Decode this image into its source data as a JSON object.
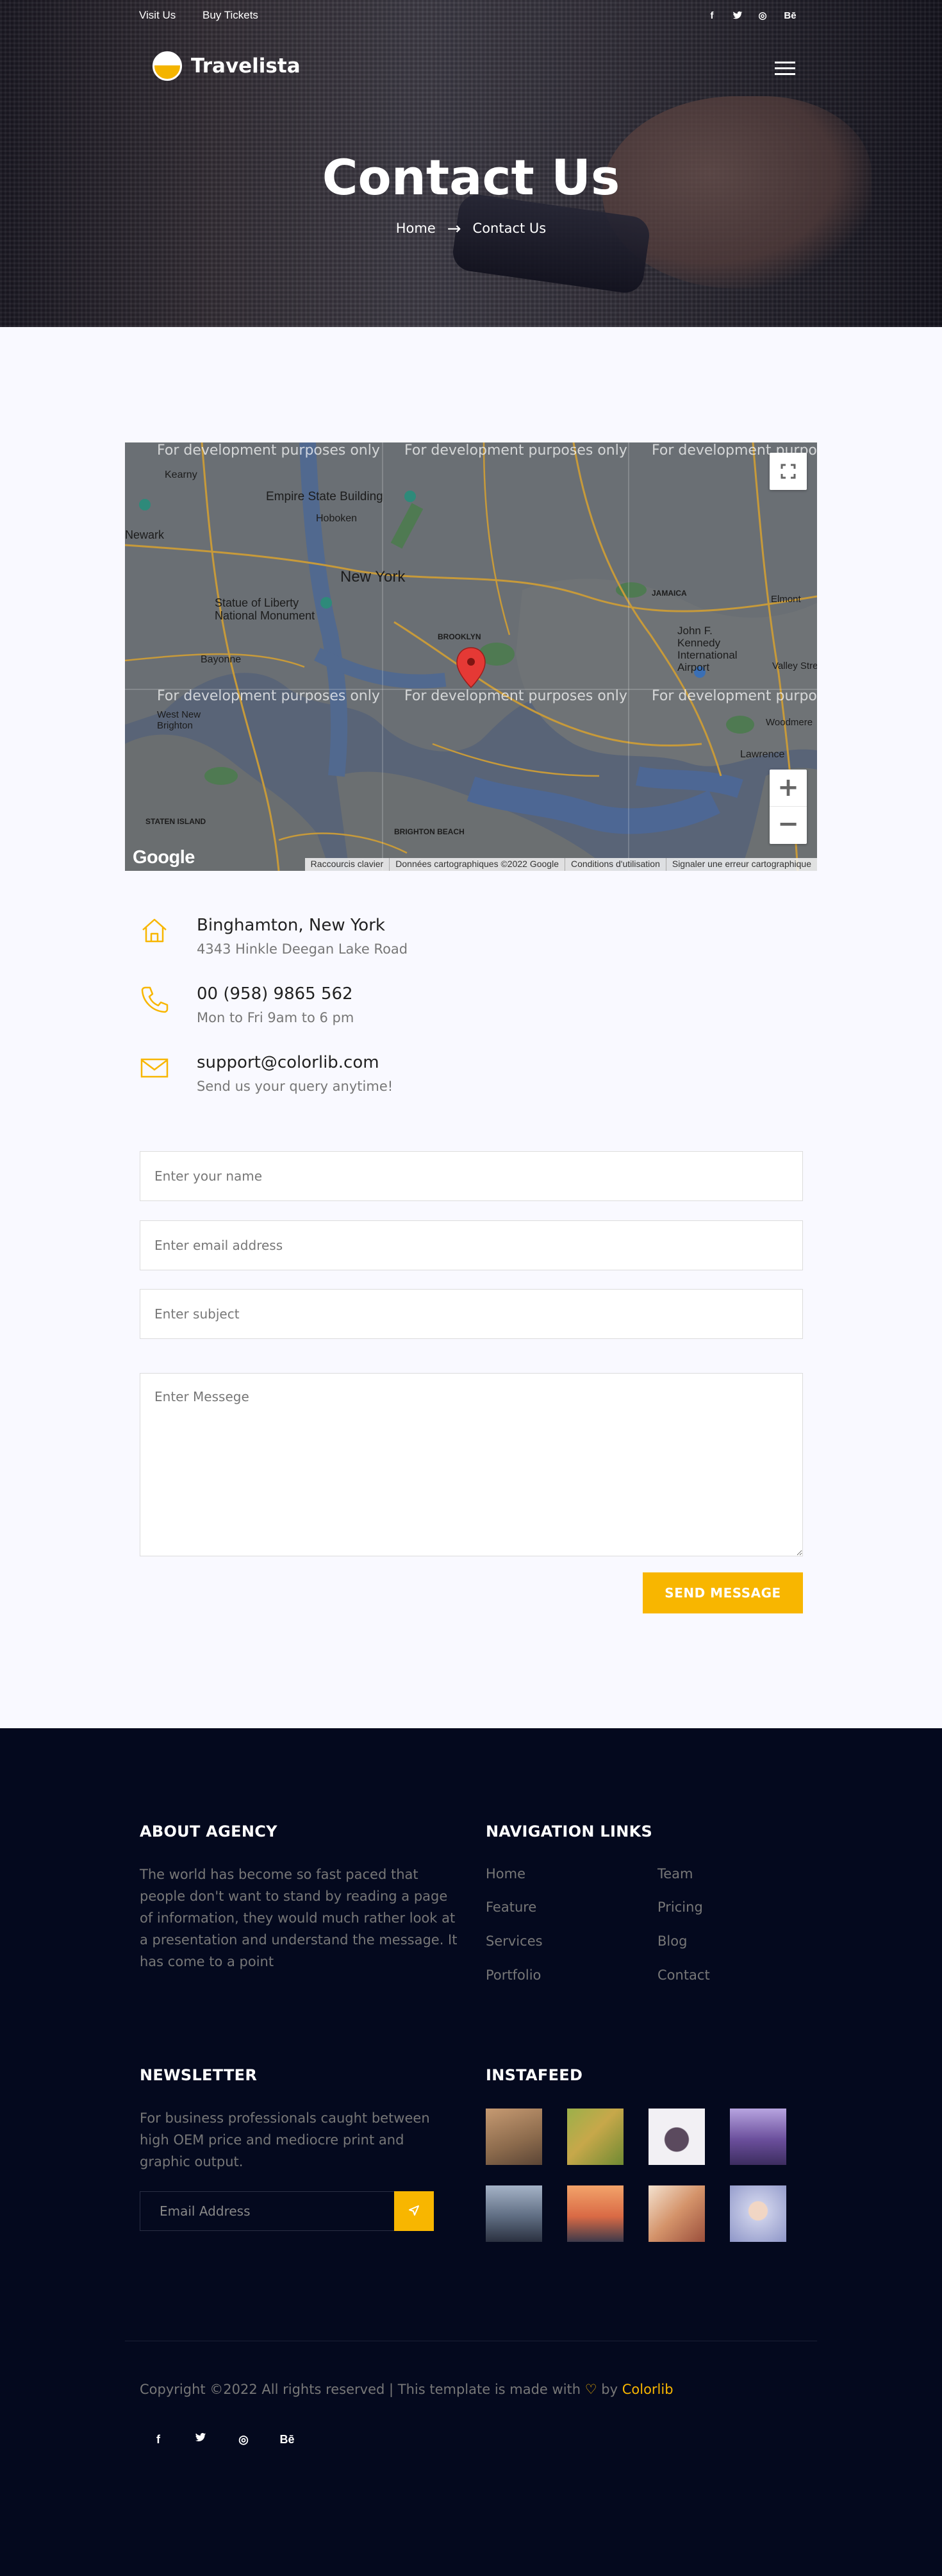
{
  "topbar": {
    "links": [
      "Visit Us",
      "Buy Tickets"
    ],
    "social": [
      {
        "icon": "facebook-icon",
        "glyph": "f"
      },
      {
        "icon": "twitter-icon",
        "glyph": "t"
      },
      {
        "icon": "dribbble-icon",
        "glyph": "◎"
      },
      {
        "icon": "behance-icon",
        "glyph": "Bē"
      }
    ]
  },
  "brand": {
    "name": "Travelista"
  },
  "hero": {
    "title": "Contact Us",
    "breadcrumb": {
      "home": "Home",
      "current": "Contact Us"
    }
  },
  "map": {
    "dev_notice": "For development purposes only",
    "labels": {
      "kearny": "Kearny",
      "esb": "Empire State Building",
      "hoboken": "Hoboken",
      "newark": "Newark",
      "newyork": "New York",
      "liberty": "Statue of Liberty National Monument",
      "bayonne": "Bayonne",
      "brooklyn": "BROOKLYN",
      "westnb": "West New Brighton",
      "jfk": "John F. Kennedy International Airport",
      "woodmere": "Woodmere",
      "lawrence": "Lawrence",
      "valleyst": "Valley Stre",
      "elmont": "Elmont",
      "jamaica": "JAMAICA",
      "statenisland": "STATEN ISLAND",
      "brighton": "BRIGHTON BEACH"
    },
    "attribution": [
      "Raccourcis clavier",
      "Données cartographiques ©2022 Google",
      "Conditions d'utilisation",
      "Signaler une erreur cartographique"
    ],
    "google": "Google",
    "zoom_in": "+",
    "zoom_out": "−"
  },
  "contact_info": [
    {
      "icon": "home-icon",
      "title": "Binghamton, New York",
      "subtitle": "4343 Hinkle Deegan Lake Road"
    },
    {
      "icon": "phone-icon",
      "title": "00 (958) 9865 562",
      "subtitle": "Mon to Fri 9am to 6 pm"
    },
    {
      "icon": "envelope-icon",
      "title": "support@colorlib.com",
      "subtitle": "Send us your query anytime!"
    }
  ],
  "form": {
    "name_placeholder": "Enter your name",
    "email_placeholder": "Enter email address",
    "subject_placeholder": "Enter subject",
    "message_placeholder": "Enter Messege",
    "submit_label": "SEND MESSAGE"
  },
  "footer": {
    "about": {
      "heading": "ABOUT AGENCY",
      "text": "The world has become so fast paced that people don't want to stand by reading a page of information, they would much rather look at a presentation and understand the message. It has come to a point"
    },
    "nav": {
      "heading": "NAVIGATION LINKS",
      "col1": [
        "Home",
        "Feature",
        "Services",
        "Portfolio"
      ],
      "col2": [
        "Team",
        "Pricing",
        "Blog",
        "Contact"
      ]
    },
    "newsletter": {
      "heading": "NEWSLETTER",
      "text": "For business professionals caught between high OEM price and mediocre print and graphic output.",
      "placeholder": "Email Address"
    },
    "instafeed": {
      "heading": "INSTAFEED"
    },
    "copyright": {
      "prefix": "Copyright ©2022 All rights reserved | This template is made with",
      "heart": "♡",
      "by": "by",
      "link": "Colorlib"
    },
    "social": [
      {
        "icon": "facebook-icon",
        "glyph": "f"
      },
      {
        "icon": "twitter-icon",
        "glyph": "t"
      },
      {
        "icon": "dribbble-icon",
        "glyph": "◎"
      },
      {
        "icon": "behance-icon",
        "glyph": "Bē"
      }
    ]
  },
  "colors": {
    "accent": "#f8b600",
    "footer_bg": "#04091e",
    "page_bg": "#f9f9ff"
  }
}
